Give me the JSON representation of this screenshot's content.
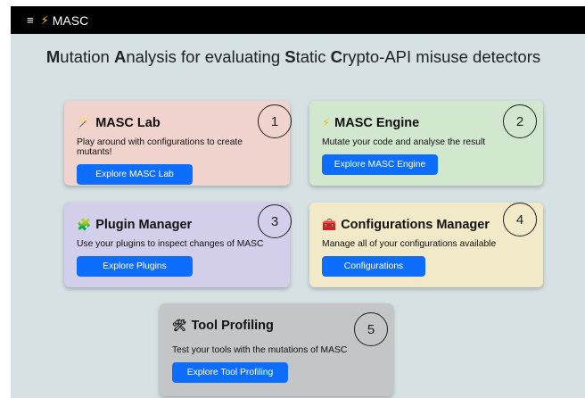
{
  "topbar": {
    "menu_icon": "≡",
    "bolt_icon": "⚡",
    "brand": "MASC"
  },
  "heading": {
    "parts": [
      {
        "b": "M",
        "t": "utation "
      },
      {
        "b": "A",
        "t": "nalysis for evaluating "
      },
      {
        "b": "S",
        "t": "tatic "
      },
      {
        "b": "C",
        "t": "rypto-API misuse detectors"
      }
    ]
  },
  "cards": [
    {
      "icon": "wand-icon",
      "icon_glyph": "🪄",
      "title": "MASC Lab",
      "desc": "Play around with configurations to create mutants!",
      "button": "Explore MASC Lab",
      "number": "1"
    },
    {
      "icon": "bolt-icon",
      "icon_glyph": "⚡",
      "title": "MASC Engine",
      "desc": "Mutate your code and analyse the result",
      "button": "Explore MASC Engine",
      "number": "2"
    },
    {
      "icon": "puzzle-icon",
      "icon_glyph": "🧩",
      "title": "Plugin Manager",
      "desc": "Use your plugins to inspect changes of MASC",
      "button": "Explore Plugins",
      "number": "3"
    },
    {
      "icon": "toolbox-icon",
      "icon_glyph": "🧰",
      "title": "Configurations Manager",
      "desc": "Manage all of your configurations available",
      "button": "Configurations",
      "number": "4"
    },
    {
      "icon": "tools-icon",
      "icon_glyph": "🛠",
      "title": "Tool Profiling",
      "desc": "Test your tools with the mutations of MASC",
      "button": "Explore Tool Profiling",
      "number": "5"
    }
  ],
  "colors": {
    "lab": "#f0d3cc",
    "engine": "#d1e8cf",
    "plugin": "#d3cfeb",
    "config": "#f1e9c8",
    "profiling": "#c3c5c7",
    "button": "#0d6efd",
    "background": "#d6e1e4"
  }
}
